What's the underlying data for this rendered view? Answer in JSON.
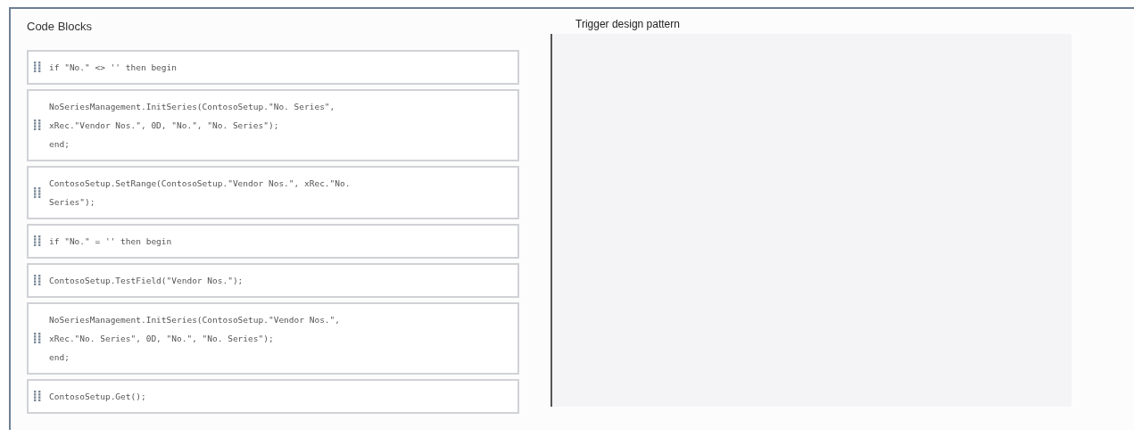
{
  "source_panel": {
    "title": "Code Blocks",
    "blocks": [
      {
        "lines": [
          "if \"No.\" <> '' then begin"
        ]
      },
      {
        "lines": [
          "NoSeriesManagement.InitSeries(ContosoSetup.\"No. Series\",",
          "xRec.\"Vendor Nos.\", 0D, \"No.\", \"No. Series\");",
          "end;"
        ]
      },
      {
        "lines": [
          "ContosoSetup.SetRange(ContosoSetup.\"Vendor Nos.\", xRec.\"No.",
          "Series\");"
        ]
      },
      {
        "lines": [
          "if \"No.\" = '' then begin"
        ]
      },
      {
        "lines": [
          "ContosoSetup.TestField(\"Vendor Nos.\");"
        ]
      },
      {
        "lines": [
          "NoSeriesManagement.InitSeries(ContosoSetup.\"Vendor Nos.\",",
          "xRec.\"No. Series\", 0D, \"No.\", \"No. Series\");",
          "end;"
        ]
      },
      {
        "lines": [
          "ContosoSetup.Get();"
        ]
      }
    ]
  },
  "answer_area": {
    "title": "Trigger design pattern"
  }
}
